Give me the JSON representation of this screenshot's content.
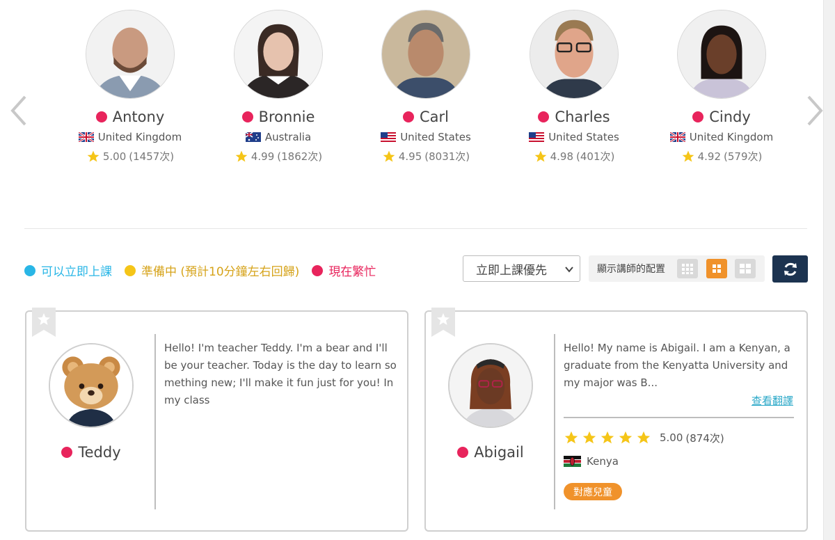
{
  "colors": {
    "available": "#29b6e6",
    "preparing": "#f5c518",
    "busy": "#e8245c",
    "accent_orange": "#f0922b",
    "refresh_bg": "#1c3350",
    "star": "#f5c518",
    "link": "#2aa8c8"
  },
  "carousel": {
    "prev_icon": "chevron-left-icon",
    "next_icon": "chevron-right-icon",
    "teachers": [
      {
        "name": "Antony",
        "country": "United Kingdom",
        "flag": "uk-flag-icon",
        "rating": "5.00",
        "count": "(1457次)",
        "status": "busy"
      },
      {
        "name": "Bronnie",
        "country": "Australia",
        "flag": "australia-flag-icon",
        "rating": "4.99",
        "count": "(1862次)",
        "status": "busy"
      },
      {
        "name": "Carl",
        "country": "United States",
        "flag": "us-flag-icon",
        "rating": "4.95",
        "count": "(8031次)",
        "status": "busy"
      },
      {
        "name": "Charles",
        "country": "United States",
        "flag": "us-flag-icon",
        "rating": "4.98",
        "count": "(401次)",
        "status": "busy"
      },
      {
        "name": "Cindy",
        "country": "United Kingdom",
        "flag": "uk-flag-icon",
        "rating": "4.92",
        "count": "(579次)",
        "status": "busy"
      }
    ]
  },
  "legend": {
    "available": "可以立即上課",
    "preparing": "準備中 (預計10分鐘左右回歸)",
    "busy": "現在繁忙"
  },
  "controls": {
    "sort_value": "立即上課優先",
    "layout_label": "顯示講師的配置",
    "layout_options": [
      "grid-small-icon",
      "grid-medium-icon",
      "grid-large-icon"
    ],
    "layout_active": 1,
    "refresh_icon": "refresh-icon"
  },
  "cards": [
    {
      "name": "Teddy",
      "status": "busy",
      "bio": "Hello! I'm teacher Teddy. I'm a bear and I'll be your teacher. Today is the day to learn something new; I'll make it fun just for you! In my class"
    },
    {
      "name": "Abigail",
      "status": "busy",
      "bio": "Hello! My name is Abigail. I am a Kenyan, a graduate from the Kenyatta University and my major was B...",
      "translate_label": "查看翻譯",
      "stars": 5,
      "rating": "5.00",
      "count": "(874次)",
      "country": "Kenya",
      "flag": "kenya-flag-icon",
      "badge": "對應兒童"
    }
  ]
}
